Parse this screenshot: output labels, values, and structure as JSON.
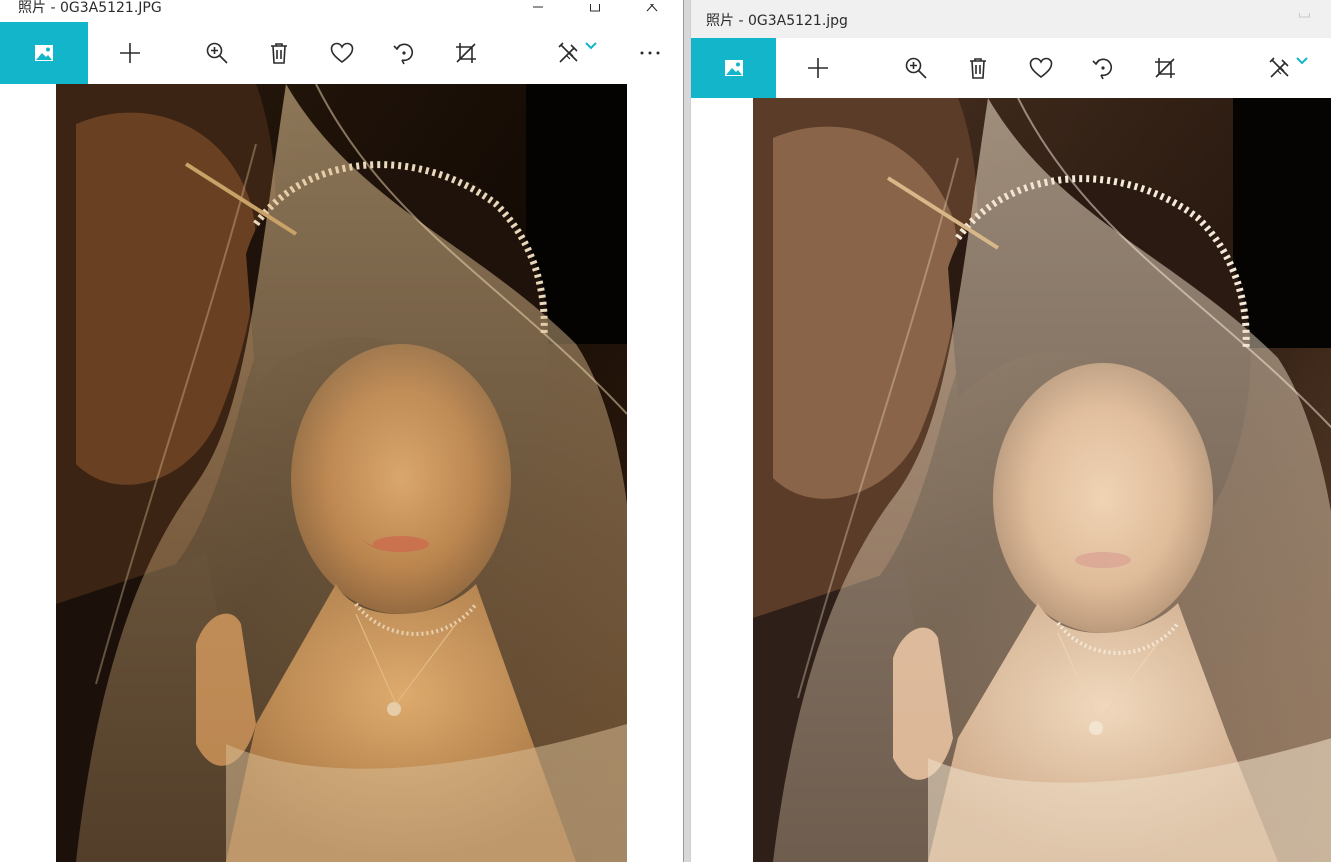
{
  "left_window": {
    "title": "照片 - 0G3A5121.JPG",
    "caption": {
      "minimize_icon": "minimize-icon",
      "maximize_icon": "maximize-icon",
      "close_icon": "close-icon"
    },
    "toolbar": [
      {
        "id": "add",
        "icon": "plus-icon"
      },
      {
        "id": "zoom",
        "icon": "zoom-in-icon"
      },
      {
        "id": "delete",
        "icon": "trash-icon"
      },
      {
        "id": "favorite",
        "icon": "heart-icon"
      },
      {
        "id": "rotate",
        "icon": "rotate-icon"
      },
      {
        "id": "crop",
        "icon": "crop-icon"
      },
      {
        "id": "edit",
        "icon": "edit-create-icon"
      },
      {
        "id": "more",
        "icon": "more-icon"
      }
    ],
    "photo_tone": "warm-dark"
  },
  "right_window": {
    "title": "照片 - 0G3A5121.jpg",
    "caption": {
      "minimize_icon": "minimize-icon",
      "maximize_icon": "maximize-icon"
    },
    "toolbar": [
      {
        "id": "add",
        "icon": "plus-icon"
      },
      {
        "id": "zoom",
        "icon": "zoom-in-icon"
      },
      {
        "id": "delete",
        "icon": "trash-icon"
      },
      {
        "id": "favorite",
        "icon": "heart-icon"
      },
      {
        "id": "rotate",
        "icon": "rotate-icon"
      },
      {
        "id": "crop",
        "icon": "crop-icon"
      },
      {
        "id": "edit",
        "icon": "edit-create-icon"
      }
    ],
    "photo_tone": "soft-bright"
  },
  "colors": {
    "accent": "#12b5c9",
    "icon": "#2b2b2b",
    "titlebar_right": "#f0f0f0"
  }
}
